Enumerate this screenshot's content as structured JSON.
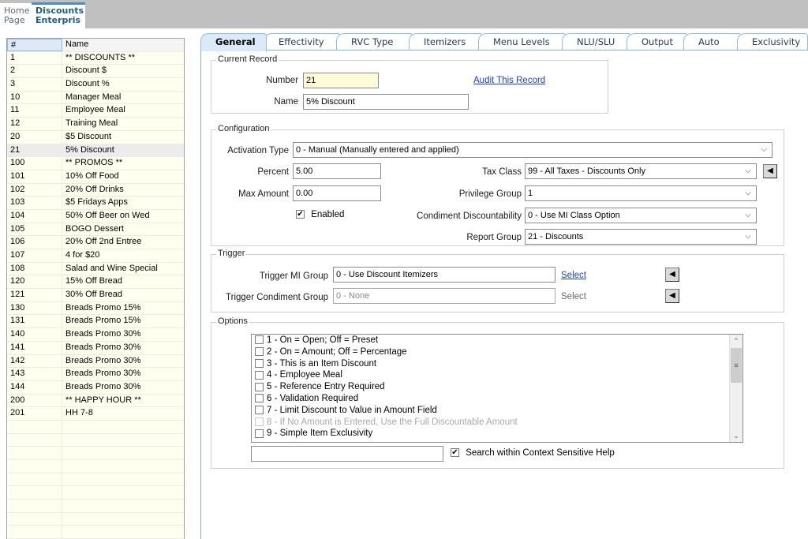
{
  "doc_tabs": {
    "home": {
      "line1": "Home",
      "line2": "Page"
    },
    "active": {
      "line1": "Discounts",
      "line2": "Enterpris"
    }
  },
  "grid": {
    "headers": [
      "#",
      "Name"
    ],
    "selected_number": "21",
    "rows": [
      {
        "num": "1",
        "name": "** DISCOUNTS **"
      },
      {
        "num": "2",
        "name": "Discount $"
      },
      {
        "num": "3",
        "name": "Discount %"
      },
      {
        "num": "10",
        "name": "Manager Meal"
      },
      {
        "num": "11",
        "name": "Employee Meal"
      },
      {
        "num": "12",
        "name": "Training Meal"
      },
      {
        "num": "20",
        "name": "$5 Discount"
      },
      {
        "num": "21",
        "name": "5% Discount"
      },
      {
        "num": "100",
        "name": "** PROMOS **"
      },
      {
        "num": "101",
        "name": "10% Off Food"
      },
      {
        "num": "102",
        "name": "20% Off Drinks"
      },
      {
        "num": "103",
        "name": "$5 Fridays Apps"
      },
      {
        "num": "104",
        "name": "50% Off Beer on Wed"
      },
      {
        "num": "105",
        "name": "BOGO Dessert"
      },
      {
        "num": "106",
        "name": "20% Off 2nd Entree"
      },
      {
        "num": "107",
        "name": "4 for $20"
      },
      {
        "num": "108",
        "name": "Salad and Wine Special"
      },
      {
        "num": "120",
        "name": "15% Off Bread"
      },
      {
        "num": "121",
        "name": "30% Off Bread"
      },
      {
        "num": "130",
        "name": "Breads Promo 15%"
      },
      {
        "num": "131",
        "name": "Breads Promo 15%"
      },
      {
        "num": "140",
        "name": "Breads Promo 30%"
      },
      {
        "num": "141",
        "name": "Breads Promo 30%"
      },
      {
        "num": "142",
        "name": "Breads Promo 30%"
      },
      {
        "num": "143",
        "name": "Breads Promo 30%"
      },
      {
        "num": "144",
        "name": "Breads Promo 30%"
      },
      {
        "num": "200",
        "name": "** HAPPY HOUR **"
      },
      {
        "num": "201",
        "name": "HH 7-8"
      }
    ]
  },
  "tabs": [
    {
      "label": "General",
      "active": true
    },
    {
      "label": "Effectivity"
    },
    {
      "label": "RVC Type"
    },
    {
      "label": "Itemizers"
    },
    {
      "label": "Menu Levels"
    },
    {
      "label": "NLU/SLU"
    },
    {
      "label": "Output"
    },
    {
      "label": "Auto"
    },
    {
      "label": "Exclusivity"
    }
  ],
  "current_record": {
    "legend": "Current Record",
    "number_label": "Number",
    "number_value": "21",
    "name_label": "Name",
    "name_value": "5% Discount",
    "audit_link": "Audit This Record"
  },
  "configuration": {
    "legend": "Configuration",
    "activation_type_label": "Activation Type",
    "activation_type_value": "0 - Manual (Manually entered and applied)",
    "percent_label": "Percent",
    "percent_value": "5.00",
    "max_amount_label": "Max Amount",
    "max_amount_value": "0.00",
    "enabled_label": "Enabled",
    "enabled_checked": true,
    "tax_class_label": "Tax Class",
    "tax_class_value": "99 - All Taxes - Discounts Only",
    "privilege_group_label": "Privilege Group",
    "privilege_group_value": "1",
    "condiment_label": "Condiment Discountability",
    "condiment_value": "0 - Use MI Class Option",
    "report_group_label": "Report Group",
    "report_group_value": "21 - Discounts"
  },
  "trigger": {
    "legend": "Trigger",
    "mi_group_label": "Trigger MI Group",
    "mi_group_value": "0 - Use Discount Itemizers",
    "mi_select": "Select",
    "condiment_group_label": "Trigger Condiment Group",
    "condiment_group_value": "0 - None",
    "condiment_select": "Select"
  },
  "options": {
    "legend": "Options",
    "items": [
      {
        "label": "1 - On = Open; Off = Preset",
        "checked": false
      },
      {
        "label": "2 - On = Amount; Off = Percentage",
        "checked": false
      },
      {
        "label": "3 - This is an Item Discount",
        "checked": false
      },
      {
        "label": "4 - Employee Meal",
        "checked": false
      },
      {
        "label": "5 - Reference Entry Required",
        "checked": false
      },
      {
        "label": "6 - Validation Required",
        "checked": false
      },
      {
        "label": "7 - Limit Discount to Value in Amount Field",
        "checked": false
      },
      {
        "label": "8 - If No Amount is Entered, Use the Full Discountable Amount",
        "checked": false,
        "disabled": true
      },
      {
        "label": "9 - Simple Item Exclusivity",
        "checked": false
      }
    ],
    "search_value": "",
    "search_help_label": "Search within Context Sensitive Help",
    "search_help_checked": true
  },
  "icons": {
    "chevron_down": "⌵",
    "arrow_left": "◀",
    "check": "✔",
    "scroll_up": "⌃",
    "scroll_down": "⌄",
    "grip": "≡"
  },
  "colors": {
    "tab_border": "#8fbde8",
    "active_tab_bg": "#dbe9f8",
    "grid_bg": "#fffff0",
    "link": "#1a3fd6",
    "number_field_bg": "#fffbd9"
  }
}
